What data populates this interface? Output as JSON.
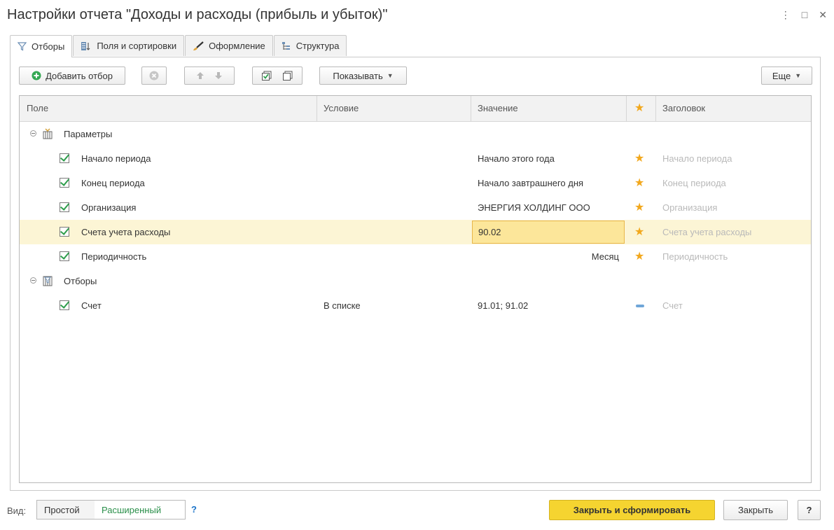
{
  "window": {
    "title": "Настройки отчета \"Доходы и расходы (прибыль и убыток)\"",
    "more_label": "⋮",
    "maximize_label": "□",
    "close_label": "✕"
  },
  "tabs": [
    {
      "label": "Отборы",
      "icon": "filter-icon",
      "active": true
    },
    {
      "label": "Поля и сортировки",
      "icon": "fields-sort-icon",
      "active": false
    },
    {
      "label": "Оформление",
      "icon": "brush-icon",
      "active": false
    },
    {
      "label": "Структура",
      "icon": "structure-icon",
      "active": false
    }
  ],
  "toolbar": {
    "add_filter_label": "Добавить отбор",
    "show_label": "Показывать",
    "more_label": "Еще"
  },
  "grid": {
    "columns": {
      "field": "Поле",
      "condition": "Условие",
      "value": "Значение",
      "star": "★",
      "heading": "Заголовок"
    },
    "groups": {
      "params": "Параметры",
      "filters": "Отборы"
    },
    "rows": [
      {
        "field": "Начало периода",
        "condition": "",
        "value": "Начало этого года",
        "marker": "star",
        "heading": "Начало периода"
      },
      {
        "field": "Конец периода",
        "condition": "",
        "value": "Начало завтрашнего дня",
        "marker": "star",
        "heading": "Конец периода"
      },
      {
        "field": "Организация",
        "condition": "",
        "value": "ЭНЕРГИЯ ХОЛДИНГ ООО",
        "marker": "star",
        "heading": "Организация"
      },
      {
        "field": "Счета учета расходы",
        "condition": "",
        "value": "90.02",
        "marker": "star",
        "heading": "Счета учета расходы",
        "selected": true
      },
      {
        "field": "Периодичность",
        "condition": "",
        "value": "Месяц",
        "marker": "star",
        "heading": "Периодичность"
      },
      {
        "field": "Счет",
        "condition": "В списке",
        "value": "91.01; 91.02",
        "marker": "dash",
        "heading": "Счет"
      }
    ]
  },
  "footer": {
    "view_label": "Вид:",
    "simple_label": "Простой",
    "extended_label": "Расширенный",
    "help_label": "?",
    "close_generate_label": "Закрыть и сформировать",
    "close_label": "Закрыть",
    "help_button_label": "?"
  },
  "colors": {
    "accent_yellow": "#f5d430",
    "selected_row": "#fcf5d5",
    "selected_cell": "#fce69a",
    "star": "#f2a81d",
    "check": "#2e9d4c",
    "green_text": "#2a8f4a"
  }
}
